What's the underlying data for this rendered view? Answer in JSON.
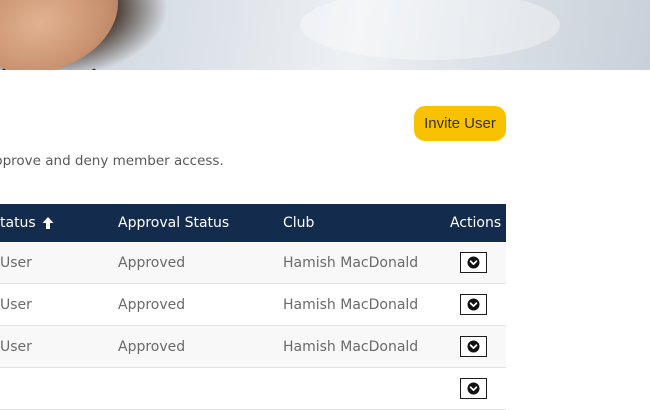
{
  "header": {
    "invite_button_label": "Invite User"
  },
  "description": "pprove and deny member access.",
  "table": {
    "columns": [
      {
        "label": "tatus",
        "sorted": "ascending"
      },
      {
        "label": "Approval Status"
      },
      {
        "label": "Club"
      },
      {
        "label": "Actions"
      }
    ],
    "rows": [
      {
        "status": "User",
        "approval": "Approved",
        "club": "Hamish MacDonald"
      },
      {
        "status": "User",
        "approval": "Approved",
        "club": "Hamish MacDonald"
      },
      {
        "status": "User",
        "approval": "Approved",
        "club": "Hamish MacDonald"
      },
      {
        "status": "",
        "approval": "",
        "club": ""
      }
    ]
  },
  "icons": {
    "sort": "arrow-up-icon",
    "action": "chevron-down-circle-icon"
  },
  "colors": {
    "accent_button": "#f8c200",
    "table_header": "#132b4d",
    "row_alt": "#f8f8f8",
    "body_text": "#6a6a6a"
  }
}
